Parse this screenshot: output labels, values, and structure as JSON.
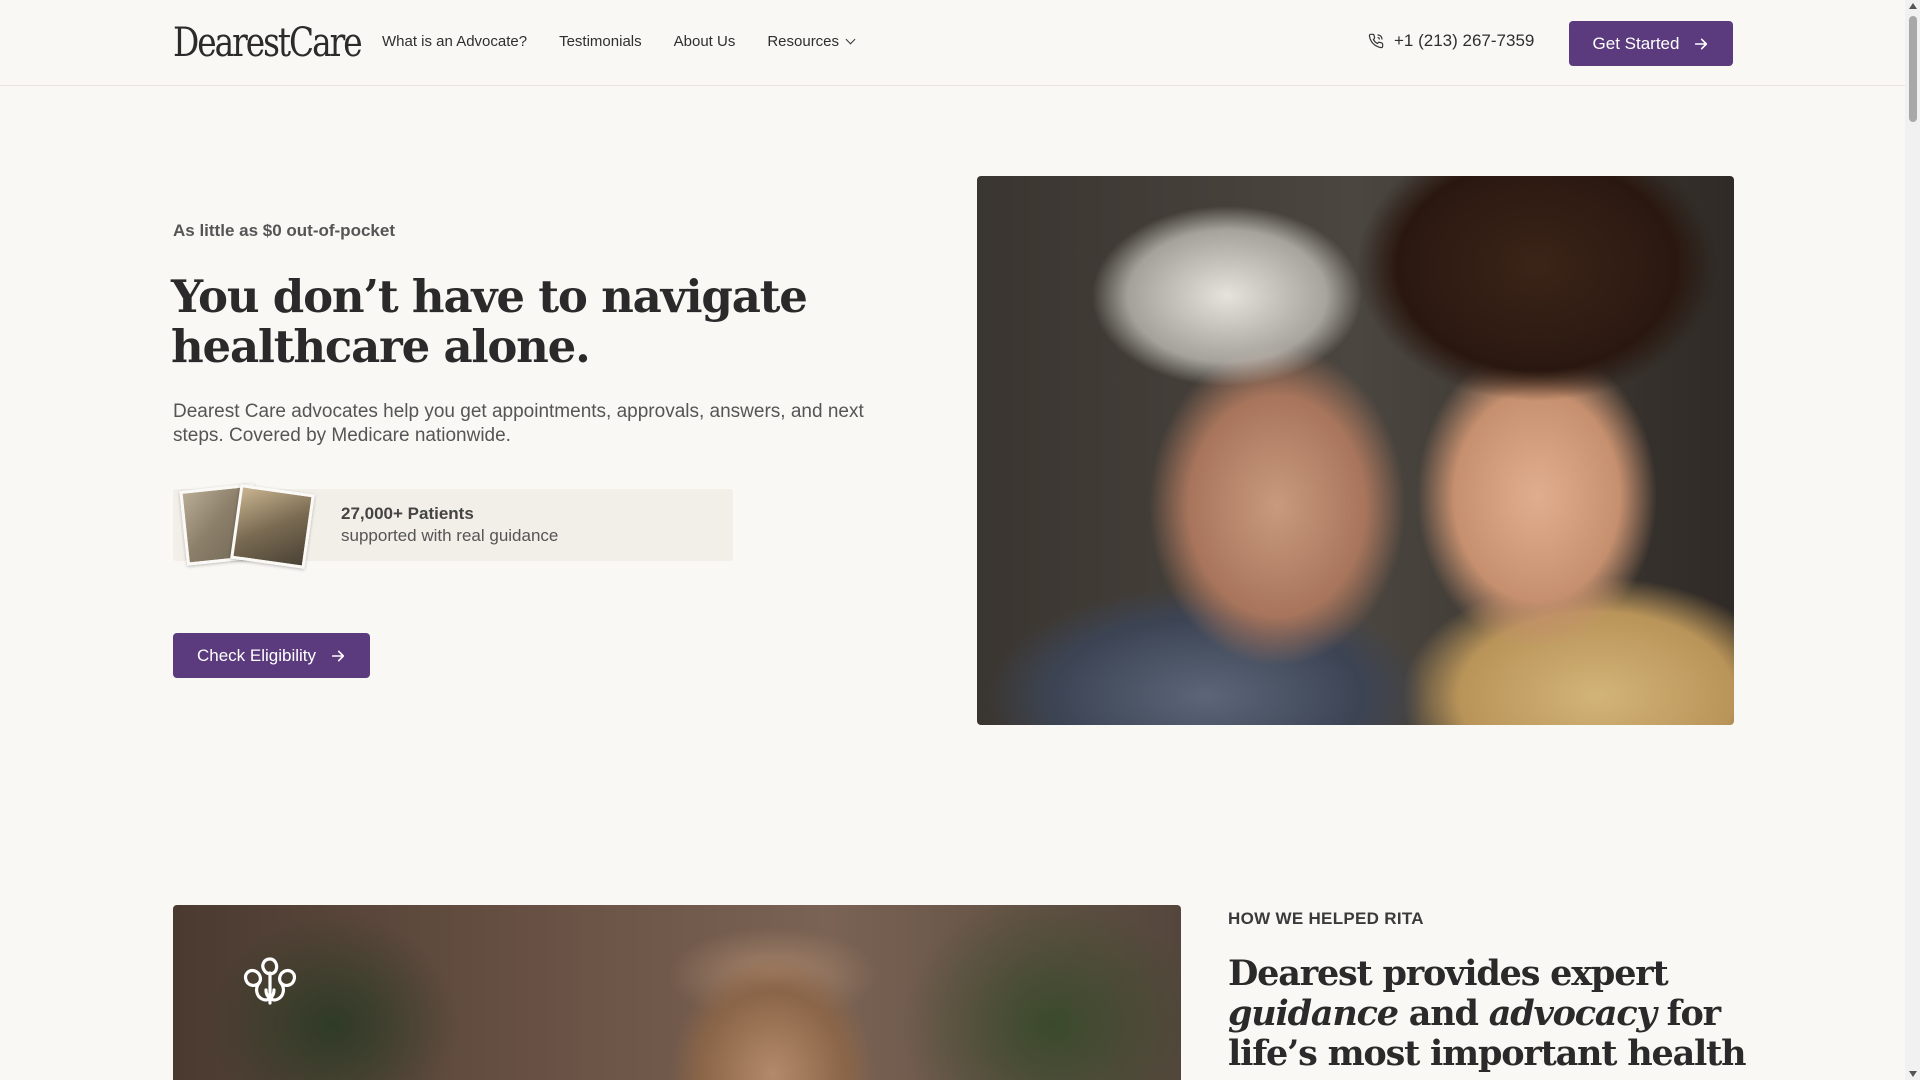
{
  "header": {
    "logo": "DearestCare",
    "nav": [
      {
        "label": "What is an Advocate?"
      },
      {
        "label": "Testimonials"
      },
      {
        "label": "About Us"
      },
      {
        "label": "Resources"
      }
    ],
    "phone": "+1 (213) 267-7359",
    "cta_label": "Get Started"
  },
  "hero": {
    "tagline": "As little as $0 out-of-pocket",
    "headline": "You don’t have to navigate healthcare alone.",
    "subtext": "Dearest Care advocates help you get appointments, approvals, answers, and next steps. Covered by Medicare nationwide.",
    "stats_title": "27,000+ Patients",
    "stats_subtitle": "supported with real guidance",
    "cta_label": "Check Eligibility"
  },
  "story": {
    "eyebrow": "HOW WE HELPED RITA",
    "headline_1": "Dearest provides expert ",
    "headline_em1": "guidance",
    "headline_2": " and ",
    "headline_em2": "advocacy",
    "headline_3": " for life’s most important health moments."
  },
  "colors": {
    "brand": "#5b3b7d",
    "background": "#faf8f5",
    "text": "#2a2a2a"
  },
  "icons": {
    "phone": "phone-icon",
    "arrow": "arrow-right-icon",
    "chevron": "chevron-down-icon",
    "brand_mark": "brand-mark-icon"
  }
}
